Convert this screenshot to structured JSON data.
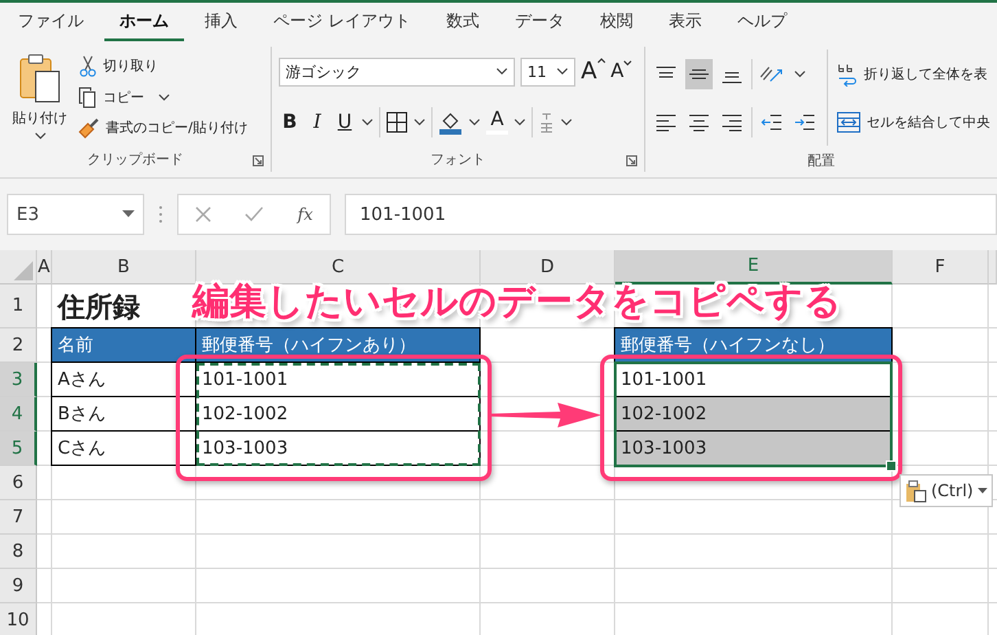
{
  "ribbon_tabs": [
    {
      "label": "ファイル",
      "selected": false
    },
    {
      "label": "ホーム",
      "selected": true
    },
    {
      "label": "挿入",
      "selected": false
    },
    {
      "label": "ページ レイアウト",
      "selected": false
    },
    {
      "label": "数式",
      "selected": false
    },
    {
      "label": "データ",
      "selected": false
    },
    {
      "label": "校閲",
      "selected": false
    },
    {
      "label": "表示",
      "selected": false
    },
    {
      "label": "ヘルプ",
      "selected": false
    }
  ],
  "clipboard": {
    "paste": "貼り付け",
    "cut": "切り取り",
    "copy": "コピー",
    "format_painter": "書式のコピー/貼り付け",
    "group_label": "クリップボード"
  },
  "font": {
    "font_name": "游ゴシック",
    "font_size": "11",
    "grow_font": "A",
    "shrink_font": "A",
    "bold": "B",
    "italic": "I",
    "underline": "U",
    "font_color": "A",
    "group_label": "フォント"
  },
  "alignment": {
    "vertical": [
      {
        "kind": "top",
        "selected": false
      },
      {
        "kind": "middle",
        "selected": true
      },
      {
        "kind": "bottom",
        "selected": false
      }
    ],
    "wrap_text": "折り返して全体を表",
    "merge": "セルを結合して中央",
    "group_label": "配置"
  },
  "formula_bar": {
    "name_box": "E3",
    "function_label": "fx",
    "formula": "101-1001"
  },
  "sheet": {
    "columns": [
      {
        "label": "A",
        "selected": false
      },
      {
        "label": "B",
        "selected": false
      },
      {
        "label": "C",
        "selected": false
      },
      {
        "label": "D",
        "selected": false
      },
      {
        "label": "E",
        "selected": true
      },
      {
        "label": "F",
        "selected": false
      }
    ],
    "rows": [
      {
        "label": "1",
        "selected": false
      },
      {
        "label": "2",
        "selected": false
      },
      {
        "label": "3",
        "selected": true
      },
      {
        "label": "4",
        "selected": true
      },
      {
        "label": "5",
        "selected": true
      },
      {
        "label": "6",
        "selected": false
      },
      {
        "label": "7",
        "selected": false
      },
      {
        "label": "8",
        "selected": false
      },
      {
        "label": "9",
        "selected": false
      },
      {
        "label": "10",
        "selected": false
      }
    ],
    "title": "住所録",
    "headers": {
      "name": "名前",
      "with_hyphen": "郵便番号（ハイフンあり）",
      "without_hyphen": "郵便番号（ハイフンなし）"
    },
    "records": [
      {
        "name": "Aさん",
        "with_hyphen": "101-1001",
        "without_hyphen": "101-1001",
        "selected": false
      },
      {
        "name": "Bさん",
        "with_hyphen": "102-1002",
        "without_hyphen": "102-1002",
        "selected": true
      },
      {
        "name": "Cさん",
        "with_hyphen": "103-1003",
        "without_hyphen": "103-1003",
        "selected": true
      }
    ]
  },
  "annotation": {
    "title": "編集したいセルのデータをコピペする"
  },
  "paste_options": {
    "label": "(Ctrl)"
  }
}
